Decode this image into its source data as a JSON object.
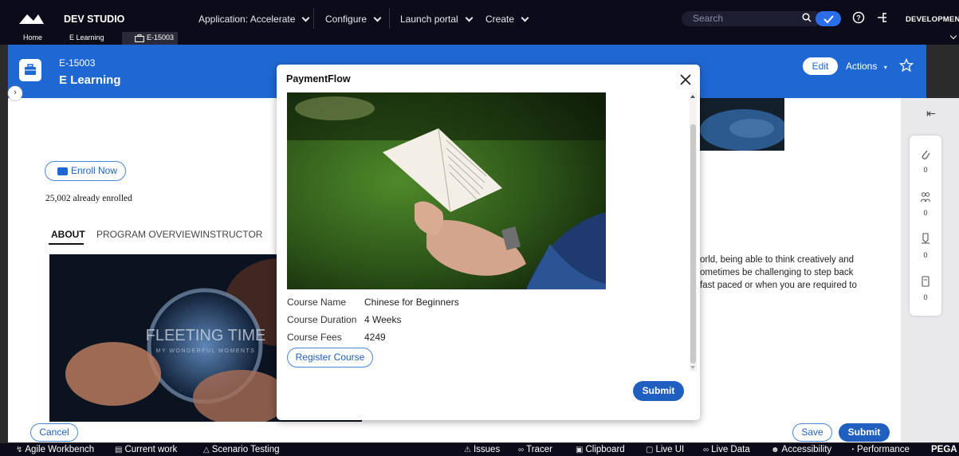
{
  "header": {
    "app_title": "DEV STUDIO",
    "menu": [
      {
        "label": "Application:  Accelerate"
      },
      {
        "label": "Configure"
      },
      {
        "label": "Launch portal"
      },
      {
        "label": "Create"
      }
    ],
    "search_placeholder": "Search",
    "environment": "DEVELOPMENT"
  },
  "tabs": {
    "home": "Home",
    "elearning": "E Learning",
    "case": "E-15003"
  },
  "case": {
    "id": "E-15003",
    "title": "E Learning",
    "edit_label": "Edit",
    "actions_label": "Actions"
  },
  "page": {
    "enroll_label": "Enroll Now",
    "enrolled_text": "25,002 already enrolled",
    "tabs": [
      "ABOUT",
      "PROGRAM OVERVIEW",
      "INSTRUCTOR"
    ],
    "hero_title": "FLEETING TIME",
    "hero_subtitle": "MY WONDERFUL MOMENTS",
    "paragraph_lines": [
      "orld, being able to think creatively and",
      "ometimes be challenging to step back",
      " fast paced or when you are required to"
    ],
    "cancel_label": "Cancel",
    "save_label": "Save",
    "submit_label": "Submit"
  },
  "utility": {
    "counts": [
      "0",
      "0",
      "0",
      "0"
    ]
  },
  "modal": {
    "title": "PaymentFlow",
    "fields": [
      {
        "label": "Course Name",
        "value": "Chinese for Beginners"
      },
      {
        "label": "Course Duration",
        "value": "4 Weeks"
      },
      {
        "label": "Course Fees",
        "value": "4249"
      }
    ],
    "register_label": "Register Course",
    "submit_label": "Submit"
  },
  "devbar": {
    "agile": "Agile Workbench",
    "current_work": "Current work",
    "scenario": "Scenario Testing",
    "issues": "Issues",
    "tracer": "Tracer",
    "clipboard": "Clipboard",
    "live_ui": "Live UI",
    "live_data": "Live Data",
    "accessibility": "Accessibility",
    "performance": "Performance",
    "brand": "PEGA"
  },
  "colors": {
    "header_bg": "#0b0b1a",
    "case_blue": "#1f68d4",
    "button_blue": "#1f5fbf"
  }
}
